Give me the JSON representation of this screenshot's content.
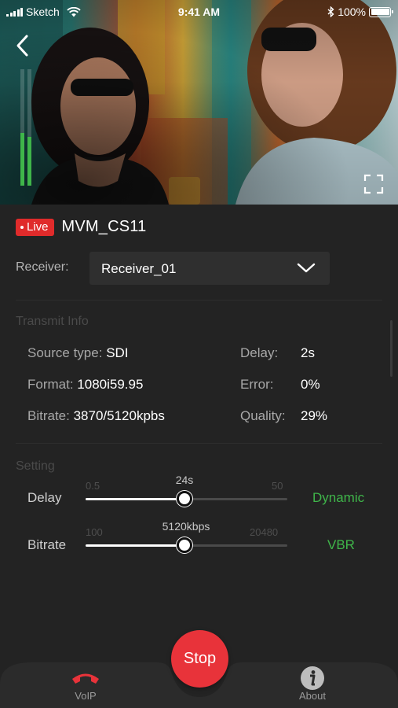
{
  "status_bar": {
    "carrier": "Sketch",
    "time": "9:41 AM",
    "battery": "100%",
    "icons": [
      "signal-icon",
      "wifi-icon",
      "bluetooth-icon",
      "battery-icon"
    ]
  },
  "video": {
    "audio_levels": [
      0.45,
      0.42
    ]
  },
  "stream": {
    "live_badge": "Live",
    "device_name": "MVM_CS11"
  },
  "receiver": {
    "label": "Receiver:",
    "value": "Receiver_01"
  },
  "transmit_info": {
    "title": "Transmit Info",
    "source_type": {
      "label": "Source type:",
      "value": "SDI"
    },
    "format": {
      "label": "Format:",
      "value": "1080i59.95"
    },
    "bitrate": {
      "label": "Bitrate:",
      "value": "3870/5120kpbs"
    },
    "delay": {
      "label": "Delay:",
      "value": "2s"
    },
    "error": {
      "label": "Error:",
      "value": "0%"
    },
    "quality": {
      "label": "Quality:",
      "value": "29%"
    }
  },
  "setting": {
    "title": "Setting",
    "delay": {
      "label": "Delay",
      "min": "0.5",
      "max": "50",
      "current": "24s",
      "fraction": 0.49,
      "mode": "Dynamic"
    },
    "bitrate": {
      "label": "Bitrate",
      "min": "100",
      "max": "20480",
      "current": "5120kbps",
      "fraction": 0.49,
      "mode": "VBR"
    }
  },
  "bottom_bar": {
    "voip_label": "VoIP",
    "stop_label": "Stop",
    "about_label": "About"
  },
  "colors": {
    "background": "#232323",
    "live_red": "#e02b2b",
    "stop_red": "#e8333a",
    "accent_green": "#3fb54a"
  }
}
